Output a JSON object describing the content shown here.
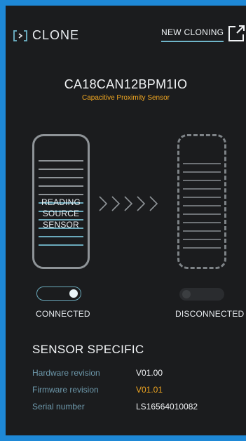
{
  "app": {
    "logo_text": "CLONE"
  },
  "header": {
    "new_cloning_label": "NEW CLONING"
  },
  "product": {
    "code": "CA18CAN12BPM1IO",
    "description": "Capacitive Proximity Sensor"
  },
  "source": {
    "label_lines": [
      "READING",
      "SOURCE",
      "SENSOR"
    ],
    "status": "CONNECTED",
    "connected": true
  },
  "target": {
    "status": "DISCONNECTED",
    "connected": false
  },
  "specific": {
    "title": "SENSOR SPECIFIC",
    "rows": [
      {
        "key": "Hardware revision",
        "value": "V01.00"
      },
      {
        "key": "Firmware revision",
        "value": "V01.01"
      },
      {
        "key": "Serial number",
        "value": "LS16564010082"
      }
    ]
  },
  "colors": {
    "background": "#1b1c1e",
    "accent": "#f0a621",
    "teal": "#6fb5c9",
    "frame": "#1e88d6"
  },
  "icons": [
    "clone-logo-icon",
    "external-link-icon",
    "chevron-right-icon"
  ]
}
